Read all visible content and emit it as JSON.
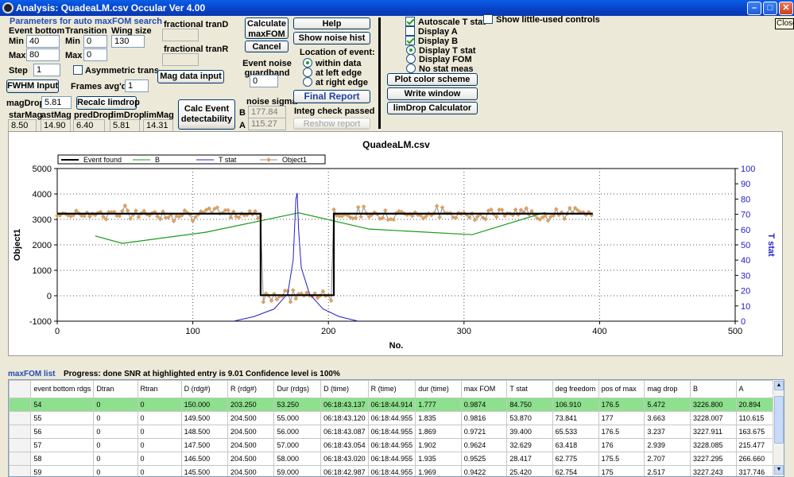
{
  "window": {
    "title": "Analysis: QuadeaLM.csv  Occular Ver 4.00",
    "close_tooltip": "Close"
  },
  "params": {
    "group_title": "Parameters for auto maxFOM search",
    "event_bottom_label": "Event bottom",
    "transition_label": "Transition",
    "wing_size_label": "Wing size",
    "min_label": "Min",
    "max_label": "Max",
    "step_label": "Step",
    "eb_min": "40",
    "eb_max": "80",
    "eb_step": "1",
    "tr_min": "0",
    "tr_max": "0",
    "wing_size": "130",
    "asym_label": "Asymmetric trans"
  },
  "frac": {
    "tranD_label": "fractional tranD",
    "tranD": "",
    "tranR_label": "fractional tranR",
    "tranR": ""
  },
  "buttons": {
    "calc_max_fom": "Calculate maxFOM",
    "cancel": "Cancel",
    "help": "Help",
    "show_noise_hist": "Show noise hist",
    "mag_data_input": "Mag data input",
    "fwhm_input": "FWHM Input",
    "recalc_limdrop": "Recalc limdrop",
    "calc_event_det": "Calc Event detectability",
    "final_report": "Final Report",
    "reshow_report": "Reshow report",
    "plot_color_scheme": "Plot color scheme",
    "write_window": "Write window",
    "limdrop_calc": "limDrop Calculator"
  },
  "frames": {
    "label": "Frames avg'd:",
    "value": "1"
  },
  "magdrop": {
    "label": "magDrop:",
    "value": "5.81"
  },
  "mags": [
    {
      "label": "starMag",
      "value": "8.50"
    },
    {
      "label": "astMag",
      "value": "14.90"
    },
    {
      "label": "predDrop",
      "value": "6.40"
    },
    {
      "label": "limDrop",
      "value": "5.81"
    },
    {
      "label": "limMag",
      "value": "14.31"
    }
  ],
  "noise": {
    "guardband_label": "Event noise guardband",
    "guardband": "0",
    "sigma_label": "noise sigma",
    "b_label": "B",
    "b_value": "177.84",
    "a_label": "A",
    "a_value": "115.27"
  },
  "location": {
    "label": "Location of event:",
    "options": [
      "within data",
      "at left edge",
      "at right edge"
    ],
    "selected": 0
  },
  "integ": "Integ check passed",
  "display": {
    "autoscale": "Autoscale T stat",
    "display_a": "Display A",
    "display_b": "Display B",
    "show_little": "Show little-used controls",
    "stat_options": [
      "Display T stat",
      "Display FOM",
      "No stat meas"
    ],
    "stat_selected": 0
  },
  "chart_data": {
    "type": "line",
    "title": "QuadeaLM.csv",
    "xlabel": "No.",
    "ylabel": "Object1",
    "y2label": "T stat",
    "xlim": [
      0,
      500
    ],
    "ylim": [
      -1000,
      5000
    ],
    "y2lim": [
      0,
      100
    ],
    "x_ticks": [
      0,
      100,
      200,
      300,
      400,
      500
    ],
    "y_ticks": [
      -1000,
      0,
      1000,
      2000,
      3000,
      4000,
      5000
    ],
    "y2_ticks": [
      0,
      10,
      20,
      30,
      40,
      50,
      60,
      70,
      80,
      90,
      100
    ],
    "legend": [
      "Event found",
      "B",
      "T stat",
      "Object1"
    ],
    "colors": {
      "event": "#000000",
      "b": "#1a9a1a",
      "tstat": "#2020c8",
      "object1": "#8c8c8c",
      "marker": "#d9a066"
    },
    "event_found": {
      "x": [
        0,
        150,
        150,
        204,
        204,
        395
      ],
      "y": [
        3227,
        3227,
        21,
        21,
        3227,
        3227
      ]
    },
    "b_series": {
      "x": [
        28,
        48,
        110,
        178,
        230,
        306,
        360
      ],
      "y": [
        2350,
        2060,
        2500,
        3260,
        2620,
        2400,
        3280
      ]
    },
    "tstat_series": {
      "x": [
        130,
        145,
        160,
        170,
        174,
        176,
        177,
        178,
        180,
        186,
        196,
        208,
        222
      ],
      "y": [
        0,
        3,
        8,
        18,
        40,
        80,
        84,
        60,
        35,
        18,
        8,
        3,
        0
      ]
    },
    "object1_levels": {
      "x_range": [
        0,
        395
      ],
      "high": 3230,
      "low": 21,
      "event_start": 150,
      "event_end": 204,
      "noise": 178
    }
  },
  "progress": {
    "list_title": "maxFOM list",
    "status": "Progress: done  SNR at highlighted entry is 9.01   Confidence level is  100%"
  },
  "table": {
    "headers": [
      "event bottom rdgs",
      "Dtran",
      "Rtran",
      "D (rdg#)",
      "R (rdg#)",
      "Dur (rdgs)",
      "D (time)",
      "R (time)",
      "dur (time)",
      "max FOM",
      "T stat",
      "deg freedom",
      "pos of max",
      "mag drop",
      "B",
      "A"
    ],
    "rows": [
      [
        "54",
        "0",
        "0",
        "150.000",
        "203.250",
        "53.250",
        "06:18:43.137",
        "06:18:44.914",
        "1.777",
        "0.9874",
        "84.750",
        "106.910",
        "176.5",
        "5.472",
        "3226.800",
        "20.894"
      ],
      [
        "55",
        "0",
        "0",
        "149.500",
        "204.500",
        "55.000",
        "06:18:43.120",
        "06:18:44.955",
        "1.835",
        "0.9816",
        "53.870",
        "73.841",
        "177",
        "3.663",
        "3228.007",
        "110.615"
      ],
      [
        "56",
        "0",
        "0",
        "148.500",
        "204.500",
        "56.000",
        "06:18:43.087",
        "06:18:44.955",
        "1.869",
        "0.9721",
        "39.400",
        "65.533",
        "176.5",
        "3.237",
        "3227.911",
        "163.675"
      ],
      [
        "57",
        "0",
        "0",
        "147.500",
        "204.500",
        "57.000",
        "06:18:43.054",
        "06:18:44.955",
        "1.902",
        "0.9624",
        "32.629",
        "63.418",
        "176",
        "2.939",
        "3228.085",
        "215.477"
      ],
      [
        "58",
        "0",
        "0",
        "146.500",
        "204.500",
        "58.000",
        "06:18:43.020",
        "06:18:44.955",
        "1.935",
        "0.9525",
        "28.417",
        "62.775",
        "175.5",
        "2.707",
        "3227.295",
        "266.660"
      ],
      [
        "59",
        "0",
        "0",
        "145.500",
        "204.500",
        "59.000",
        "06:18:42.987",
        "06:18:44.955",
        "1.969",
        "0.9422",
        "25.420",
        "62.754",
        "175",
        "2.517",
        "3227.243",
        "317.746"
      ]
    ],
    "highlight_row": 0
  }
}
